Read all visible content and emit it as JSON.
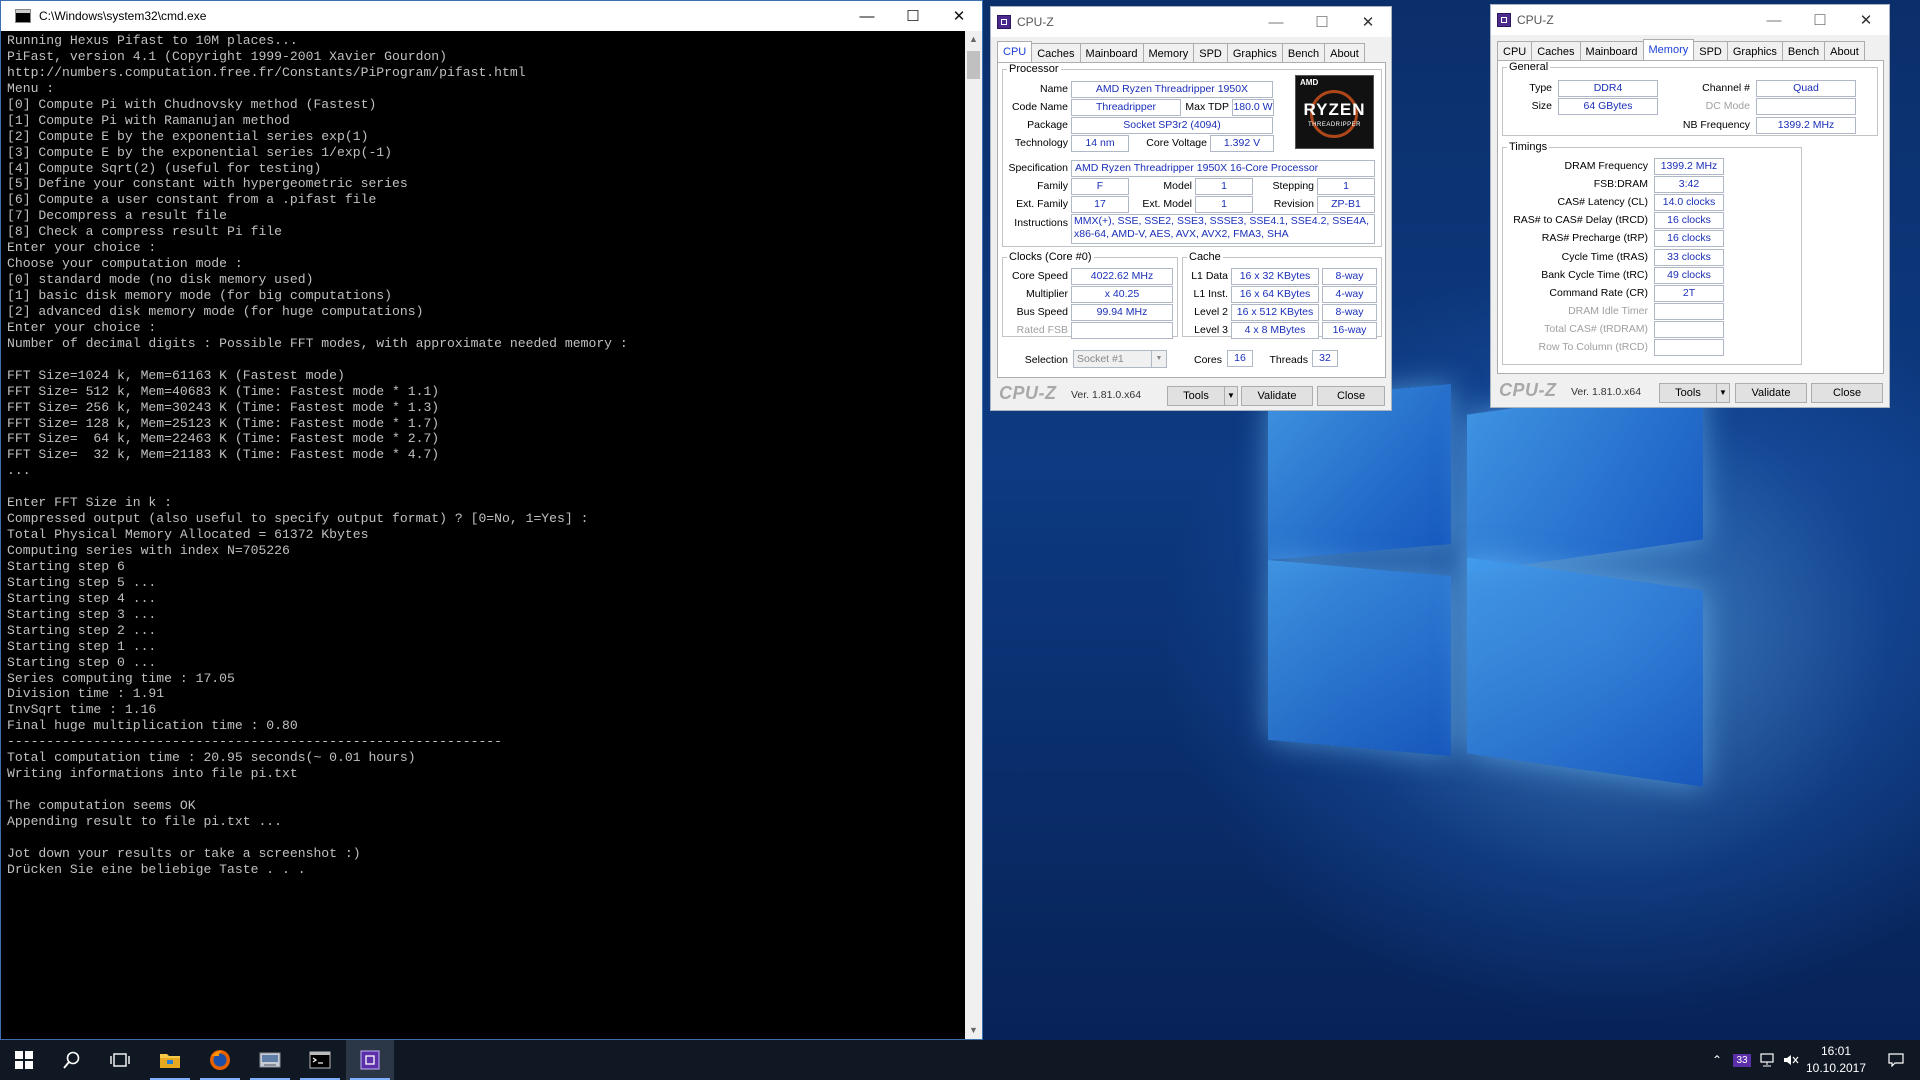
{
  "cmd": {
    "title": "C:\\Windows\\system32\\cmd.exe",
    "lines": [
      "Running Hexus Pifast to 10M places...",
      "PiFast, version 4.1 (Copyright 1999-2001 Xavier Gourdon)",
      "http://numbers.computation.free.fr/Constants/PiProgram/pifast.html",
      "Menu :",
      "[0] Compute Pi with Chudnovsky method (Fastest)",
      "[1] Compute Pi with Ramanujan method",
      "[2] Compute E by the exponential series exp(1)",
      "[3] Compute E by the exponential series 1/exp(-1)",
      "[4] Compute Sqrt(2) (useful for testing)",
      "[5] Define your constant with hypergeometric series",
      "[6] Compute a user constant from a .pifast file",
      "[7] Decompress a result file",
      "[8] Check a compress result Pi file",
      "Enter your choice :",
      "Choose your computation mode :",
      "[0] standard mode (no disk memory used)",
      "[1] basic disk memory mode (for big computations)",
      "[2] advanced disk memory mode (for huge computations)",
      "Enter your choice :",
      "Number of decimal digits : Possible FFT modes, with approximate needed memory :",
      "",
      "FFT Size=1024 k, Mem=61163 K (Fastest mode)",
      "FFT Size= 512 k, Mem=40683 K (Time: Fastest mode * 1.1)",
      "FFT Size= 256 k, Mem=30243 K (Time: Fastest mode * 1.3)",
      "FFT Size= 128 k, Mem=25123 K (Time: Fastest mode * 1.7)",
      "FFT Size=  64 k, Mem=22463 K (Time: Fastest mode * 2.7)",
      "FFT Size=  32 k, Mem=21183 K (Time: Fastest mode * 4.7)",
      "...",
      "",
      "Enter FFT Size in k :",
      "Compressed output (also useful to specify output format) ? [0=No, 1=Yes] :",
      "Total Physical Memory Allocated = 61372 Kbytes",
      "Computing series with index N=705226",
      "Starting step 6",
      "Starting step 5 ...",
      "Starting step 4 ...",
      "Starting step 3 ...",
      "Starting step 2 ...",
      "Starting step 1 ...",
      "Starting step 0 ...",
      "Series computing time : 17.05",
      "Division time : 1.91",
      "InvSqrt time : 1.16",
      "Final huge multiplication time : 0.80",
      "---------------------------------------------------------------",
      "Total computation time : 20.95 seconds(~ 0.01 hours)",
      "Writing informations into file pi.txt",
      "",
      "The computation seems OK",
      "Appending result to file pi.txt ...",
      "",
      "Jot down your results or take a screenshot :)",
      "Drücken Sie eine beliebige Taste . . ."
    ]
  },
  "cpuz1": {
    "title": "CPU-Z",
    "tabs": [
      "CPU",
      "Caches",
      "Mainboard",
      "Memory",
      "SPD",
      "Graphics",
      "Bench",
      "About"
    ],
    "active_tab": "CPU",
    "processor": {
      "legend": "Processor",
      "name_label": "Name",
      "name": "AMD Ryzen Threadripper 1950X",
      "codename_label": "Code Name",
      "codename": "Threadripper",
      "maxtdp_label": "Max TDP",
      "maxtdp": "180.0 W",
      "package_label": "Package",
      "package": "Socket SP3r2 (4094)",
      "technology_label": "Technology",
      "technology": "14 nm",
      "corevoltage_label": "Core Voltage",
      "corevoltage": "1.392 V",
      "spec_label": "Specification",
      "spec": "AMD Ryzen Threadripper 1950X 16-Core Processor",
      "family_label": "Family",
      "family": "F",
      "model_label": "Model",
      "model": "1",
      "stepping_label": "Stepping",
      "stepping": "1",
      "extfamily_label": "Ext. Family",
      "extfamily": "17",
      "extmodel_label": "Ext. Model",
      "extmodel": "1",
      "revision_label": "Revision",
      "revision": "ZP-B1",
      "instructions_label": "Instructions",
      "instructions": "MMX(+), SSE, SSE2, SSE3, SSSE3, SSE4.1, SSE4.2, SSE4A, x86-64, AMD-V, AES, AVX, AVX2, FMA3, SHA",
      "logo_amd": "AMD",
      "logo_word": "RYZEN",
      "logo_sub": "THREADRIPPER"
    },
    "clocks": {
      "legend": "Clocks (Core #0)",
      "corespeed_label": "Core Speed",
      "corespeed": "4022.62 MHz",
      "multiplier_label": "Multiplier",
      "multiplier": "x 40.25",
      "busspeed_label": "Bus Speed",
      "busspeed": "99.94 MHz",
      "ratedfsb_label": "Rated FSB",
      "ratedfsb": ""
    },
    "cache": {
      "legend": "Cache",
      "l1d_label": "L1 Data",
      "l1d": "16 x 32 KBytes",
      "l1d_way": "8-way",
      "l1i_label": "L1 Inst.",
      "l1i": "16 x 64 KBytes",
      "l1i_way": "4-way",
      "l2_label": "Level 2",
      "l2": "16 x 512 KBytes",
      "l2_way": "8-way",
      "l3_label": "Level 3",
      "l3": "4 x 8 MBytes",
      "l3_way": "16-way"
    },
    "selection_label": "Selection",
    "selection": "Socket #1",
    "cores_label": "Cores",
    "cores": "16",
    "threads_label": "Threads",
    "threads": "32",
    "brand": "CPU-Z",
    "version": "Ver. 1.81.0.x64",
    "tools": "Tools",
    "validate": "Validate",
    "close": "Close"
  },
  "cpuz2": {
    "title": "CPU-Z",
    "tabs": [
      "CPU",
      "Caches",
      "Mainboard",
      "Memory",
      "SPD",
      "Graphics",
      "Bench",
      "About"
    ],
    "active_tab": "Memory",
    "general": {
      "legend": "General",
      "type_label": "Type",
      "type": "DDR4",
      "channel_label": "Channel #",
      "channel": "Quad",
      "size_label": "Size",
      "size": "64 GBytes",
      "dcmode_label": "DC Mode",
      "dcmode": "",
      "nbfreq_label": "NB Frequency",
      "nbfreq": "1399.2 MHz"
    },
    "timings": {
      "legend": "Timings",
      "rows": [
        {
          "label": "DRAM Frequency",
          "value": "1399.2 MHz",
          "dim": false
        },
        {
          "label": "FSB:DRAM",
          "value": "3:42",
          "dim": false
        },
        {
          "label": "CAS# Latency (CL)",
          "value": "14.0 clocks",
          "dim": false
        },
        {
          "label": "RAS# to CAS# Delay (tRCD)",
          "value": "16 clocks",
          "dim": false
        },
        {
          "label": "RAS# Precharge (tRP)",
          "value": "16 clocks",
          "dim": false
        },
        {
          "label": "Cycle Time (tRAS)",
          "value": "33 clocks",
          "dim": false
        },
        {
          "label": "Bank Cycle Time (tRC)",
          "value": "49 clocks",
          "dim": false
        },
        {
          "label": "Command Rate (CR)",
          "value": "2T",
          "dim": false
        },
        {
          "label": "DRAM Idle Timer",
          "value": "",
          "dim": true
        },
        {
          "label": "Total CAS# (tRDRAM)",
          "value": "",
          "dim": true
        },
        {
          "label": "Row To Column (tRCD)",
          "value": "",
          "dim": true
        }
      ]
    },
    "brand": "CPU-Z",
    "version": "Ver. 1.81.0.x64",
    "tools": "Tools",
    "validate": "Validate",
    "close": "Close"
  },
  "taskbar": {
    "icons": [
      "windows-start-icon",
      "search-icon",
      "task-view-icon",
      "file-explorer-icon",
      "firefox-icon",
      "pifast-icon",
      "cmd-icon",
      "cpuz-icon"
    ],
    "tray_badge": "33",
    "time": "16:01",
    "date": "10.10.2017"
  },
  "colors": {
    "cmd_text": "#c0c0c0",
    "cpuz_value": "#1a2fb8",
    "cpuz_active_tab": "#1a3fd6",
    "taskbar_bg": "#101923"
  }
}
